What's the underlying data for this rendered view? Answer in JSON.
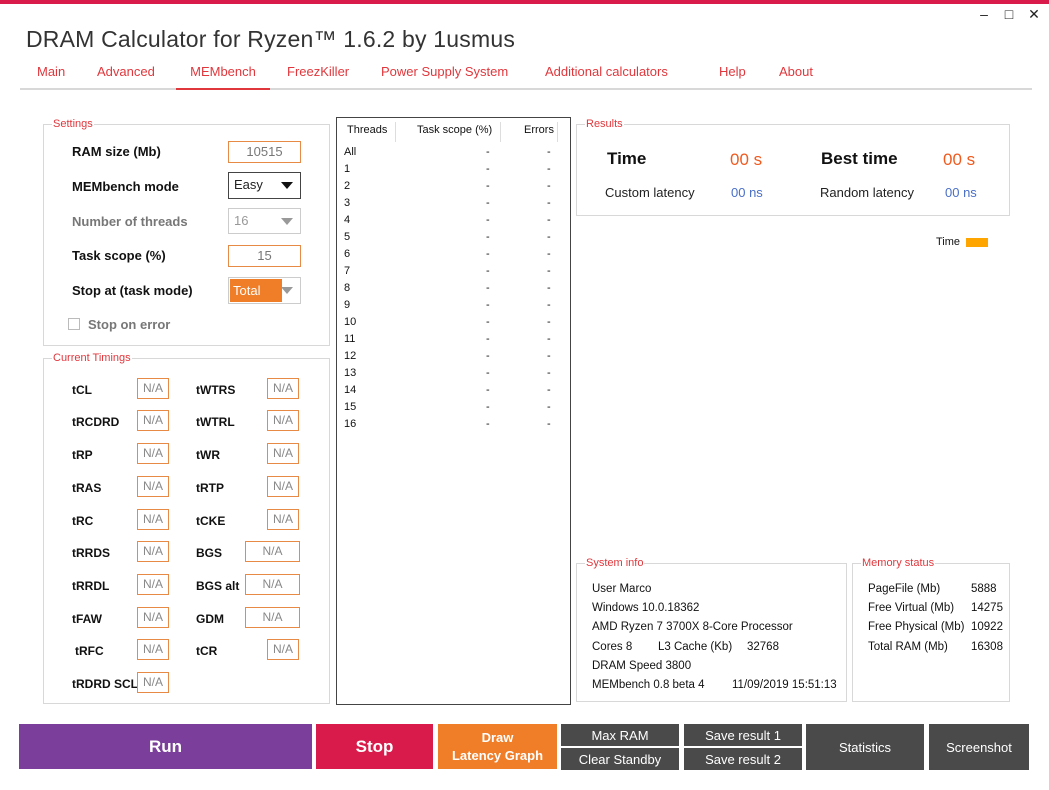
{
  "window": {
    "title": "DRAM Calculator for Ryzen™ 1.6.2 by 1usmus",
    "minimize_glyph": "–",
    "maximize_glyph": "□",
    "close_glyph": "✕"
  },
  "tabs": [
    {
      "label": "Main"
    },
    {
      "label": "Advanced"
    },
    {
      "label": "MEMbench",
      "active": true
    },
    {
      "label": "FreezKiller"
    },
    {
      "label": "Power Supply System"
    },
    {
      "label": "Additional calculators"
    },
    {
      "label": "Help"
    },
    {
      "label": "About"
    }
  ],
  "settings": {
    "legend": "Settings",
    "ram_size_label": "RAM size (Mb)",
    "ram_size_value": "10515",
    "mode_label": "MEMbench mode",
    "mode_value": "Easy",
    "threads_label": "Number of threads",
    "threads_value": "16",
    "task_scope_label": "Task scope (%)",
    "task_scope_value": "15",
    "stop_at_label": "Stop at (task mode)",
    "stop_at_value": "Total",
    "stop_on_error_label": "Stop on error",
    "stop_on_error_checked": false
  },
  "timings": {
    "legend": "Current Timings",
    "items": [
      {
        "label": "tCL",
        "value": "N/A"
      },
      {
        "label": "tWTRS",
        "value": "N/A"
      },
      {
        "label": "tRCDRD",
        "value": "N/A"
      },
      {
        "label": "tWTRL",
        "value": "N/A"
      },
      {
        "label": "tRP",
        "value": "N/A"
      },
      {
        "label": "tWR",
        "value": "N/A"
      },
      {
        "label": "tRAS",
        "value": "N/A"
      },
      {
        "label": "tRTP",
        "value": "N/A"
      },
      {
        "label": "tRC",
        "value": "N/A"
      },
      {
        "label": "tCKE",
        "value": "N/A"
      },
      {
        "label": "tRRDS",
        "value": "N/A"
      },
      {
        "label": "BGS",
        "value": "N/A"
      },
      {
        "label": "tRRDL",
        "value": "N/A"
      },
      {
        "label": "BGS alt",
        "value": "N/A"
      },
      {
        "label": "tFAW",
        "value": "N/A"
      },
      {
        "label": "GDM",
        "value": "N/A"
      },
      {
        "label": "tRFC",
        "value": "N/A"
      },
      {
        "label": "tCR",
        "value": "N/A"
      },
      {
        "label": "tRDRD SCL",
        "value": "N/A"
      }
    ]
  },
  "threads_table": {
    "headers": [
      "Threads",
      "Task scope (%)",
      "Errors"
    ],
    "rows": [
      [
        "All",
        "-",
        "-"
      ],
      [
        "1",
        "-",
        "-"
      ],
      [
        "2",
        "-",
        "-"
      ],
      [
        "3",
        "-",
        "-"
      ],
      [
        "4",
        "-",
        "-"
      ],
      [
        "5",
        "-",
        "-"
      ],
      [
        "6",
        "-",
        "-"
      ],
      [
        "7",
        "-",
        "-"
      ],
      [
        "8",
        "-",
        "-"
      ],
      [
        "9",
        "-",
        "-"
      ],
      [
        "10",
        "-",
        "-"
      ],
      [
        "11",
        "-",
        "-"
      ],
      [
        "12",
        "-",
        "-"
      ],
      [
        "13",
        "-",
        "-"
      ],
      [
        "14",
        "-",
        "-"
      ],
      [
        "15",
        "-",
        "-"
      ],
      [
        "16",
        "-",
        "-"
      ]
    ]
  },
  "results": {
    "legend": "Results",
    "time_label": "Time",
    "time_value": "00 s",
    "best_time_label": "Best time",
    "best_time_value": "00 s",
    "custom_latency_label": "Custom latency",
    "custom_latency_value": "00 ns",
    "random_latency_label": "Random latency",
    "random_latency_value": "00 ns"
  },
  "graph": {
    "legend_label": "Time",
    "legend_color": "#ffa500"
  },
  "system_info": {
    "legend": "System info",
    "user": "User Marco",
    "os": "Windows 10.0.18362",
    "cpu": "AMD Ryzen 7 3700X 8-Core Processor",
    "cores": "Cores 8",
    "l3_label": "L3 Cache (Kb)",
    "l3_value": "32768",
    "dram_speed": "DRAM Speed 3800",
    "membench_version": "MEMbench 0.8 beta 4",
    "datetime": "11/09/2019 15:51:13"
  },
  "memory_status": {
    "legend": "Memory status",
    "rows": [
      {
        "label": "PageFile (Mb)",
        "value": "5888"
      },
      {
        "label": "Free Virtual (Mb)",
        "value": "14275"
      },
      {
        "label": "Free Physical (Mb)",
        "value": "10922"
      },
      {
        "label": "Total RAM (Mb)",
        "value": "16308"
      }
    ]
  },
  "buttons": {
    "run": "Run",
    "stop": "Stop",
    "draw_line1": "Draw",
    "draw_line2": "Latency Graph",
    "max_ram": "Max RAM",
    "clear_standby": "Clear Standby",
    "save_result_1": "Save result 1",
    "save_result_2": "Save result 2",
    "statistics": "Statistics",
    "screenshot": "Screenshot"
  },
  "colors": {
    "accent_red": "#d81b4a",
    "tab_text": "#e0373c",
    "run": "#7b3f9b",
    "draw": "#f07d27",
    "gray_button": "#4a4a4a",
    "result_value": "#f05a1e",
    "latency_value": "#4a6fc7"
  }
}
